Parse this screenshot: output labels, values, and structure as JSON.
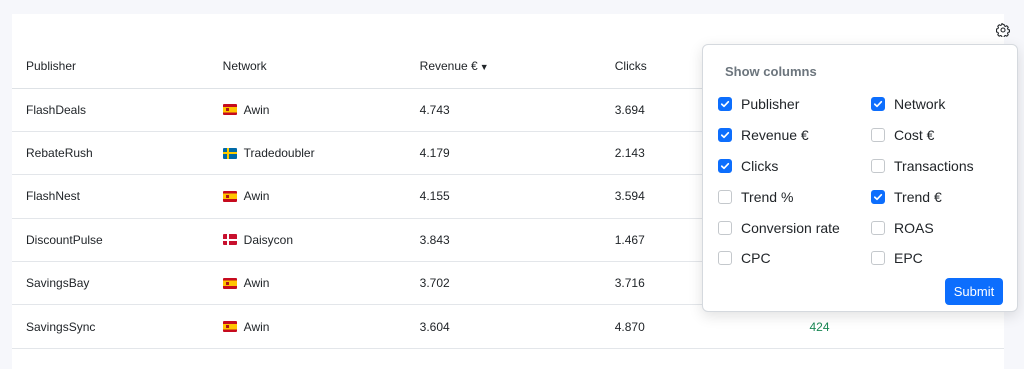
{
  "table": {
    "headers": [
      "Publisher",
      "Network",
      "Revenue €",
      "Clicks",
      "",
      ""
    ],
    "sort_indicator": "▼",
    "rows": [
      {
        "publisher": "FlashDeals",
        "network": "Awin",
        "flag": "es",
        "revenue": "4.743",
        "clicks": "3.694",
        "trend": ""
      },
      {
        "publisher": "RebateRush",
        "network": "Tradedoubler",
        "flag": "se",
        "revenue": "4.179",
        "clicks": "2.143",
        "trend": ""
      },
      {
        "publisher": "FlashNest",
        "network": "Awin",
        "flag": "es",
        "revenue": "4.155",
        "clicks": "3.594",
        "trend": ""
      },
      {
        "publisher": "DiscountPulse",
        "network": "Daisycon",
        "flag": "dk",
        "revenue": "3.843",
        "clicks": "1.467",
        "trend": ""
      },
      {
        "publisher": "SavingsBay",
        "network": "Awin",
        "flag": "es",
        "revenue": "3.702",
        "clicks": "3.716",
        "trend": ""
      },
      {
        "publisher": "SavingsSync",
        "network": "Awin",
        "flag": "es",
        "revenue": "3.604",
        "clicks": "4.870",
        "trend": "424"
      }
    ]
  },
  "settings": {
    "icon": "gear-icon",
    "popover": {
      "title": "Show columns",
      "options": [
        {
          "label": "Publisher",
          "checked": true
        },
        {
          "label": "Network",
          "checked": true
        },
        {
          "label": "Revenue €",
          "checked": true
        },
        {
          "label": "Cost €",
          "checked": false
        },
        {
          "label": "Clicks",
          "checked": true
        },
        {
          "label": "Transactions",
          "checked": false
        },
        {
          "label": "Trend %",
          "checked": false
        },
        {
          "label": "Trend €",
          "checked": true
        },
        {
          "label": "Conversion rate",
          "checked": false
        },
        {
          "label": "ROAS",
          "checked": false
        },
        {
          "label": "CPC",
          "checked": false
        },
        {
          "label": "EPC",
          "checked": false
        }
      ],
      "submit_label": "Submit"
    }
  },
  "colors": {
    "accent": "#0d6efd",
    "positive": "#198754",
    "background": "#f6f7fb"
  }
}
